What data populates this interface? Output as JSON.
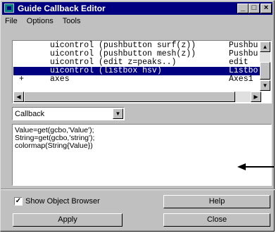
{
  "window": {
    "title": "Guide Callback Editor",
    "controls": [
      "_",
      "□",
      "×"
    ]
  },
  "menu": [
    "File",
    "Options",
    "Tools"
  ],
  "object_list": [
    {
      "prefix": "",
      "text": "uicontrol (pushbutton surf(z))",
      "type": "Pushbu",
      "selected": false
    },
    {
      "prefix": "",
      "text": "uicontrol (pushbutton mesh(z))",
      "type": "Pushbu",
      "selected": false
    },
    {
      "prefix": "",
      "text": "uicontrol (edit z=peaks..)",
      "type": "edit",
      "selected": false
    },
    {
      "prefix": "",
      "text": "uicontrol (listbox hsv)",
      "type": "Listbo",
      "selected": true
    },
    {
      "prefix": "+",
      "text": "axes",
      "type": "Axes1",
      "selected": false
    }
  ],
  "callback_select": {
    "value": "Callback"
  },
  "code_lines": [
    "Value=get(gcbo,'Value');",
    "String=get(gcbo,'string');",
    "colormap(String{Value})"
  ],
  "show_object_browser": {
    "label": "Show Object Browser",
    "checked": true
  },
  "buttons": {
    "help": "Help",
    "apply": "Apply",
    "close": "Close"
  }
}
